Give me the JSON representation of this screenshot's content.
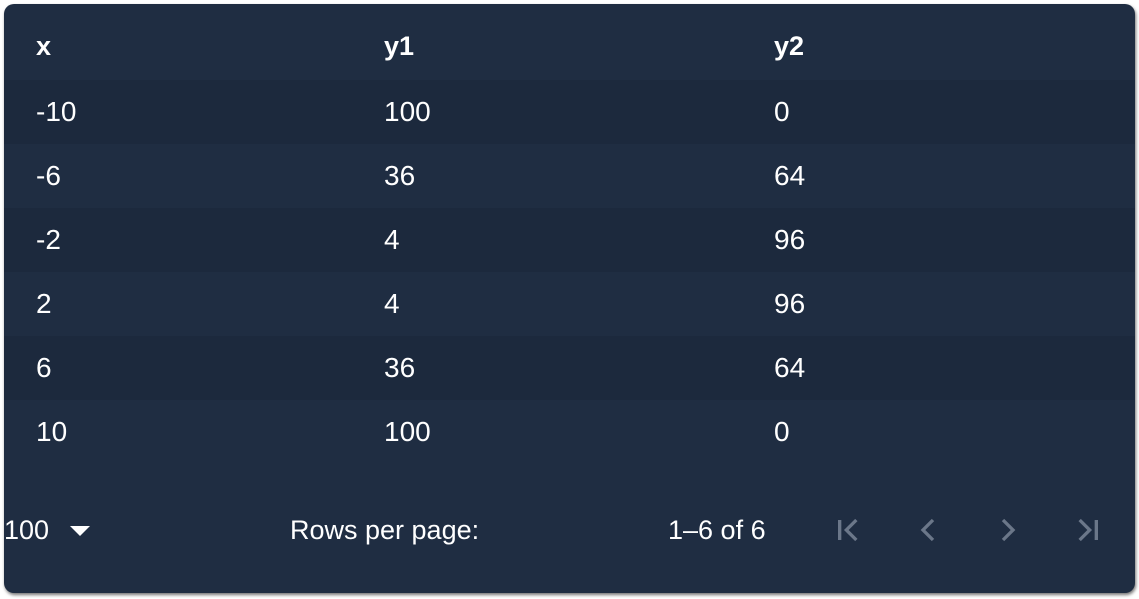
{
  "table": {
    "columns": [
      "x",
      "y1",
      "y2"
    ],
    "rows": [
      [
        "-10",
        "100",
        "0"
      ],
      [
        "-6",
        "36",
        "64"
      ],
      [
        "-2",
        "4",
        "96"
      ],
      [
        "2",
        "4",
        "96"
      ],
      [
        "6",
        "36",
        "64"
      ],
      [
        "10",
        "100",
        "0"
      ]
    ]
  },
  "pagination": {
    "rows_per_page_label": "Rows per page:",
    "rows_per_page_value": "100",
    "range_text": "1–6 of 6",
    "first_page_icon": "first-page-icon",
    "prev_page_icon": "chevron-left-icon",
    "next_page_icon": "chevron-right-icon",
    "last_page_icon": "last-page-icon",
    "disabled_icon_color": "#6b7789"
  },
  "colors": {
    "panel_bg": "#1f2d42",
    "alt_row_bg": "#1c293d",
    "text": "#ffffff"
  }
}
